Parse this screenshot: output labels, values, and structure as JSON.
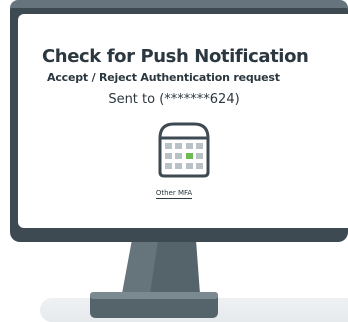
{
  "screen": {
    "title": "Check for Push Notification",
    "subtitle": "Accept / Reject Authentication request",
    "sent_to": "Sent to  (*******624)",
    "other_mfa_link": "Other MFA"
  },
  "icons": {
    "calendar": "calendar-icon"
  },
  "colors": {
    "frame": "#3e4a51",
    "text": "#2c3840",
    "accent": "#6dbb55"
  }
}
